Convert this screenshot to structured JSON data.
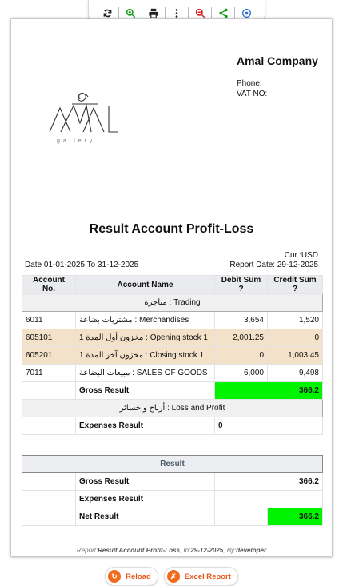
{
  "toolbar": {
    "icons": [
      "reload-icon",
      "zoom-in-icon",
      "print-icon",
      "more-icon",
      "zoom-out-icon",
      "share-icon",
      "settings-icon"
    ]
  },
  "header": {
    "company": "Amal Company",
    "phone_label": "Phone:",
    "vat_label": "VAT NO:"
  },
  "logo": {
    "text": "AMAL",
    "subtext": "g a l l e r y"
  },
  "report": {
    "title": "Result Account Profit-Loss",
    "currency": "Cur.:USD",
    "date_range": "Date 01-01-2025 To 31-12-2025",
    "report_date": "Report Date: 29-12-2025"
  },
  "table": {
    "headers": [
      "Account No.",
      "Account Name",
      "Debit Sum ?",
      "Credit Sum ?"
    ],
    "trading_group": "متاجرة : Trading",
    "rows": [
      {
        "no": "6011",
        "name": "مشتريات بضاعة : Merchandises",
        "debit": "3,654",
        "credit": "1,520"
      },
      {
        "no": "605101",
        "name": "مخزون أول المدة 1 : Opening stock 1",
        "debit": "2,001.25",
        "credit": "0"
      },
      {
        "no": "605201",
        "name": "مخزون آخر المدة 1 : Closing stock 1",
        "debit": "0",
        "credit": "1,003.45"
      },
      {
        "no": "7011",
        "name": "مبيعات البضاعة : SALES OF GOODS",
        "debit": "6,000",
        "credit": "9,498"
      }
    ],
    "gross_label": "Gross Result",
    "gross_value": "366.2",
    "loss_profit_group": "أرباح و خسائر : Loss and Profit",
    "expenses_label": "Expenses Result",
    "expenses_value": "0"
  },
  "summary": {
    "header": "Result",
    "gross_label": "Gross Result",
    "gross_value": "366.2",
    "expenses_label": "Expenses Result",
    "net_label": "Net Result",
    "net_value": "366.2"
  },
  "footer": {
    "report_label": "Report:",
    "report_name": "Result Account Profit-Loss",
    "in_label": ",  In:",
    "in_date": "29-12-2025",
    "by_label": ",  By:",
    "by_user": "developer"
  },
  "buttons": {
    "reload": "Reload",
    "excel": "Excel Report"
  }
}
